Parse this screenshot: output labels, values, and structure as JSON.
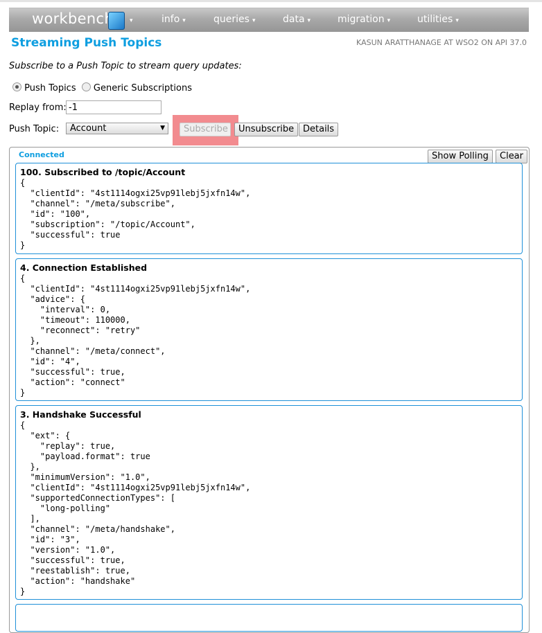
{
  "nav": {
    "logo": "workbench",
    "items": [
      "info",
      "queries",
      "data",
      "migration",
      "utilities"
    ],
    "caret": "▾"
  },
  "header": {
    "title": "Streaming Push Topics",
    "user": "KASUN ARATTHANAGE AT WSO2 ON API 37.0"
  },
  "intro": "Subscribe to a Push Topic to stream query updates:",
  "mode": {
    "options": [
      "Push Topics",
      "Generic Subscriptions"
    ],
    "selected": "Push Topics"
  },
  "replay": {
    "label": "Replay from:",
    "value": "-1"
  },
  "topic": {
    "label": "Push Topic:",
    "value": "Account"
  },
  "buttons": {
    "subscribe": "Subscribe",
    "unsubscribe": "Unsubscribe",
    "details": "Details",
    "show_polling": "Show Polling",
    "clear": "Clear"
  },
  "status": "Connected",
  "messages": [
    {
      "title": "100. Subscribed to /topic/Account",
      "body": "{\n  \"clientId\": \"4st1114ogxi25vp91lebj5jxfn14w\",\n  \"channel\": \"/meta/subscribe\",\n  \"id\": \"100\",\n  \"subscription\": \"/topic/Account\",\n  \"successful\": true\n}"
    },
    {
      "title": "4. Connection Established",
      "body": "{\n  \"clientId\": \"4st1114ogxi25vp91lebj5jxfn14w\",\n  \"advice\": {\n    \"interval\": 0,\n    \"timeout\": 110000,\n    \"reconnect\": \"retry\"\n  },\n  \"channel\": \"/meta/connect\",\n  \"id\": \"4\",\n  \"successful\": true,\n  \"action\": \"connect\"\n}"
    },
    {
      "title": "3. Handshake Successful",
      "body": "{\n  \"ext\": {\n    \"replay\": true,\n    \"payload.format\": true\n  },\n  \"minimumVersion\": \"1.0\",\n  \"clientId\": \"4st1114ogxi25vp91lebj5jxfn14w\",\n  \"supportedConnectionTypes\": [\n    \"long-polling\"\n  ],\n  \"channel\": \"/meta/handshake\",\n  \"id\": \"3\",\n  \"version\": \"1.0\",\n  \"successful\": true,\n  \"reestablish\": true,\n  \"action\": \"handshake\"\n}"
    }
  ]
}
